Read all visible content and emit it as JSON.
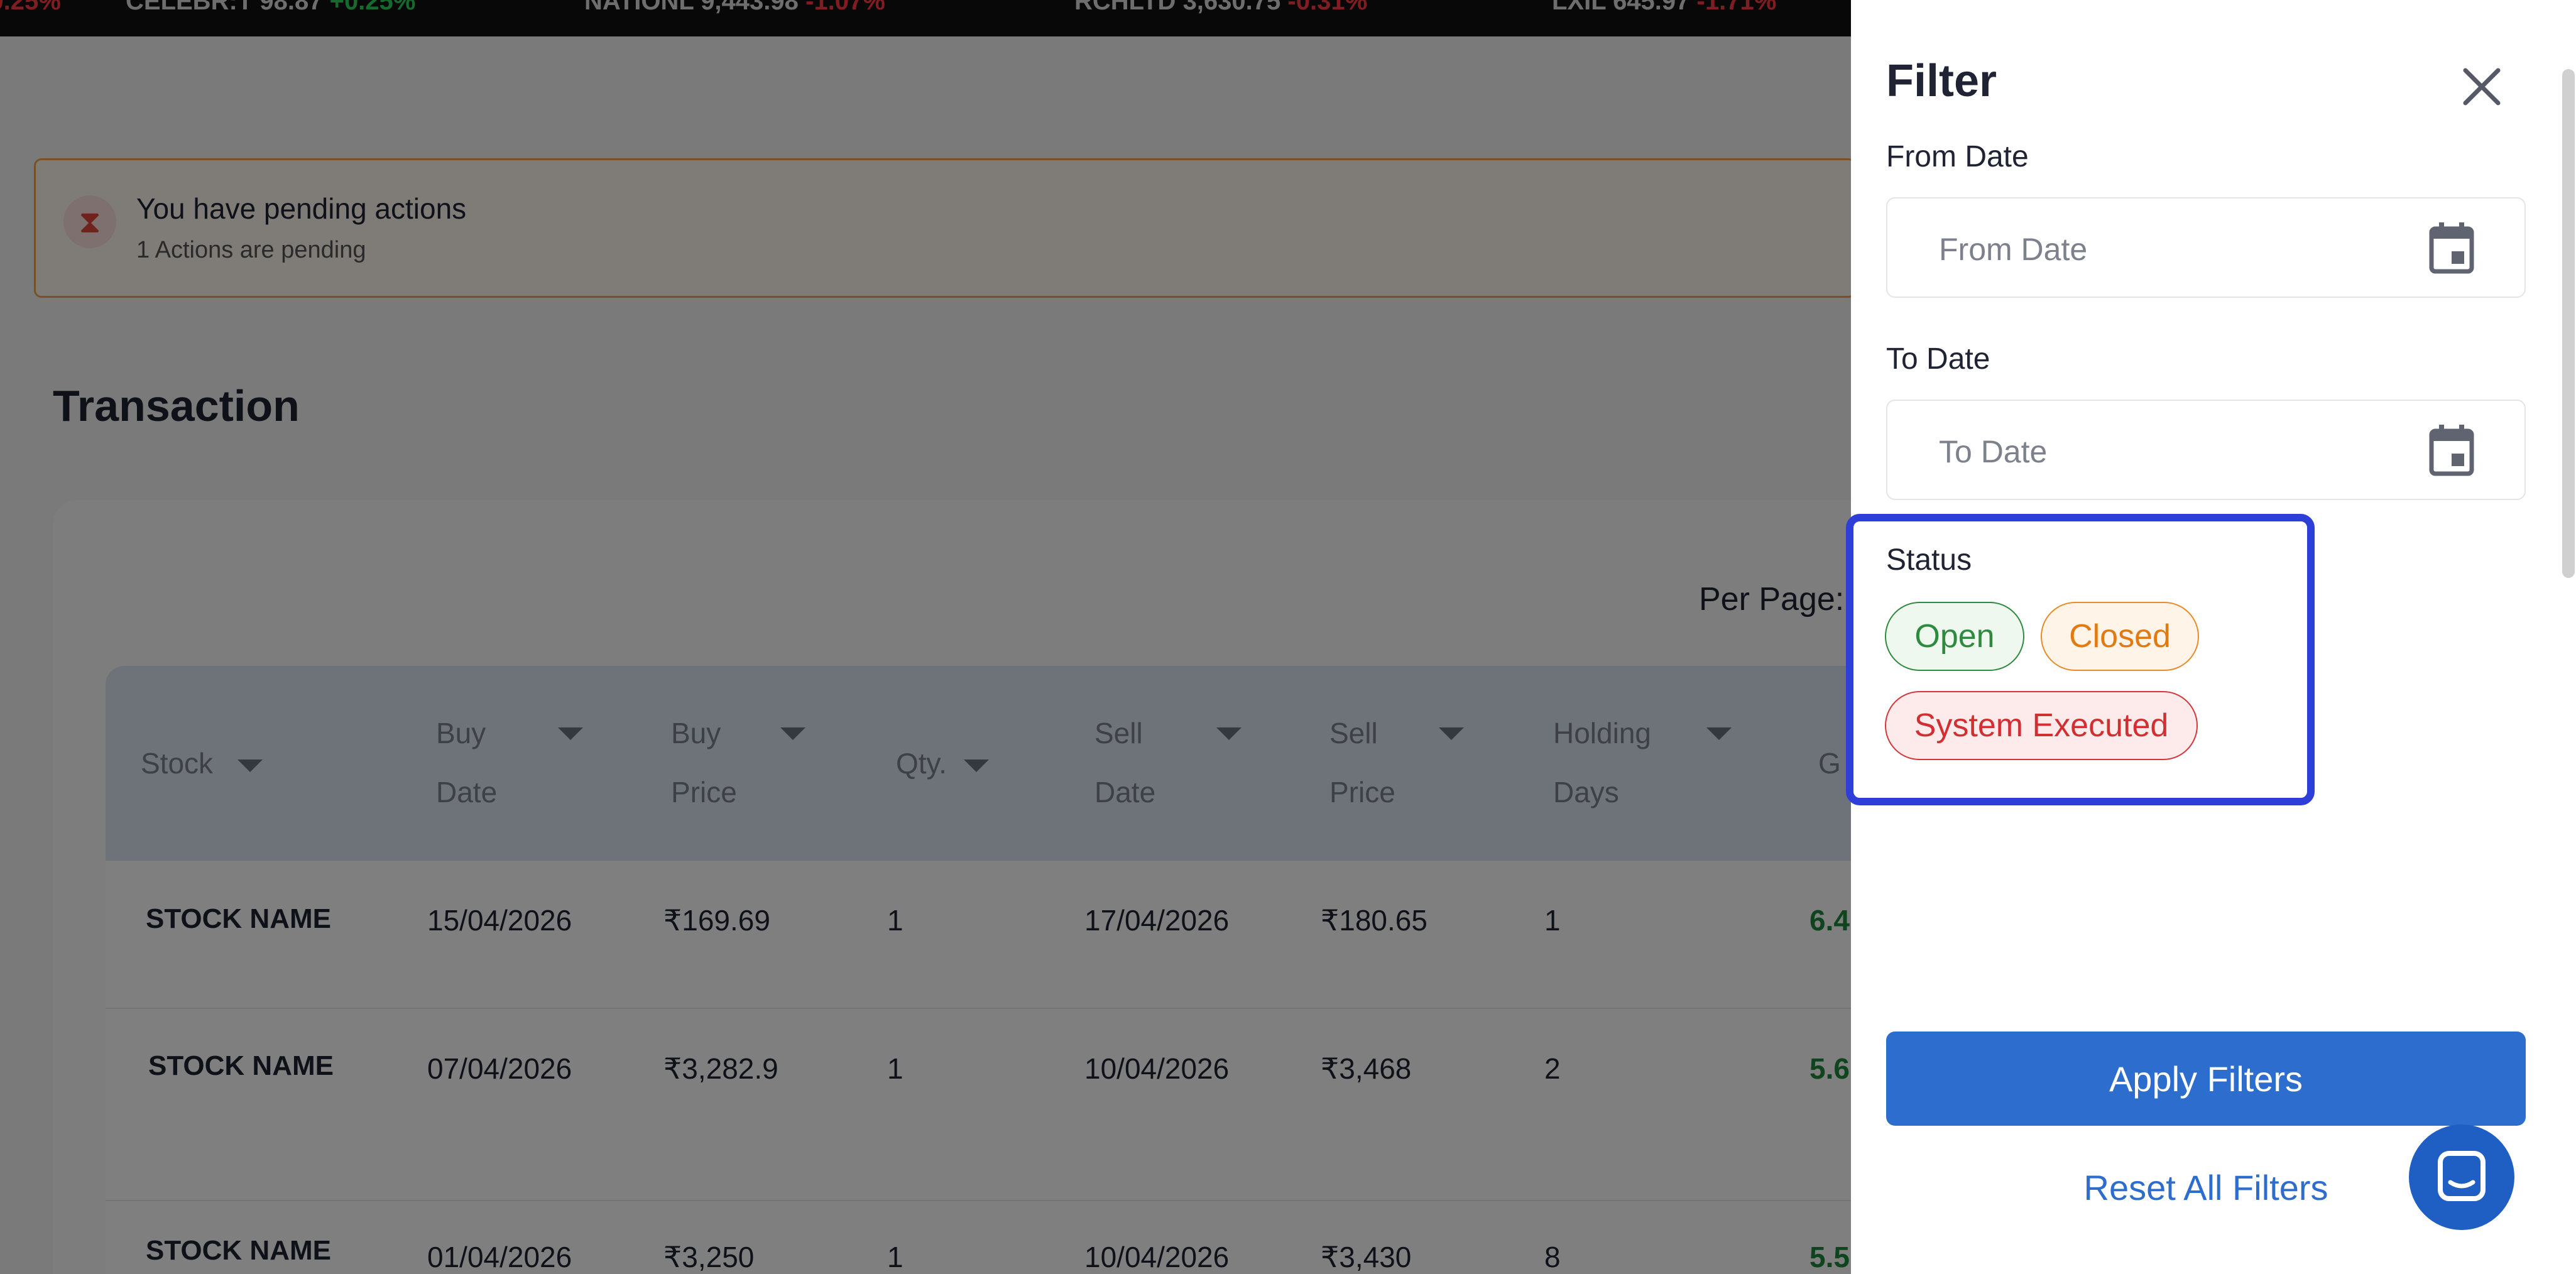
{
  "ticker": [
    {
      "sym": "CELEBR:T",
      "price": "98.87",
      "change": "+0.25%",
      "dir": "up"
    },
    {
      "sym": "NATIONL",
      "price": "9,443.98",
      "change": "-1.07%",
      "dir": "down"
    },
    {
      "sym": "RCHLTD",
      "price": "3,630.75",
      "change": "-0.31%",
      "dir": "down"
    },
    {
      "sym": "LXIL",
      "price": "645.97",
      "change": "-1.71%",
      "dir": "down"
    }
  ],
  "banner": {
    "title": "You have pending actions",
    "subtitle": "1 Actions are pending"
  },
  "page_title": "Transaction",
  "per_page_label": "Per Page:",
  "table": {
    "headers": [
      {
        "line1": "Stock",
        "line2": ""
      },
      {
        "line1": "Buy",
        "line2": "Date"
      },
      {
        "line1": "Buy",
        "line2": "Price"
      },
      {
        "line1": "Qty.",
        "line2": ""
      },
      {
        "line1": "Sell",
        "line2": "Date"
      },
      {
        "line1": "Sell",
        "line2": "Price"
      },
      {
        "line1": "Holding",
        "line2": "Days"
      },
      {
        "line1": "G",
        "line2": ""
      }
    ],
    "rows": [
      {
        "stock": "STOCK NAME",
        "buy_date": "15/04/2026",
        "buy_price": "₹169.69",
        "qty": "1",
        "sell_date": "17/04/2026",
        "sell_price": "₹180.65",
        "days": "1",
        "gain": "6.4"
      },
      {
        "stock": "STOCK NAME",
        "buy_date": "07/04/2026",
        "buy_price": "₹3,282.9",
        "qty": "1",
        "sell_date": "10/04/2026",
        "sell_price": "₹3,468",
        "days": "2",
        "gain": "5.6"
      },
      {
        "stock": "STOCK NAME",
        "buy_date": "01/04/2026",
        "buy_price": "₹3,250",
        "qty": "1",
        "sell_date": "10/04/2026",
        "sell_price": "₹3,430",
        "days": "8",
        "gain": "5.5"
      }
    ]
  },
  "filter": {
    "title": "Filter",
    "from_date_label": "From Date",
    "from_date_placeholder": "From Date",
    "to_date_label": "To Date",
    "to_date_placeholder": "To Date",
    "status_label": "Status",
    "status_options": [
      "Open",
      "Closed",
      "System Executed"
    ],
    "apply_label": "Apply Filters",
    "reset_label": "Reset All Filters"
  },
  "colors": {
    "accent": "#2d6dce",
    "highlight": "#2d3fd8",
    "open": "#2e8a3e",
    "closed": "#e27a12",
    "system": "#d22f33"
  }
}
